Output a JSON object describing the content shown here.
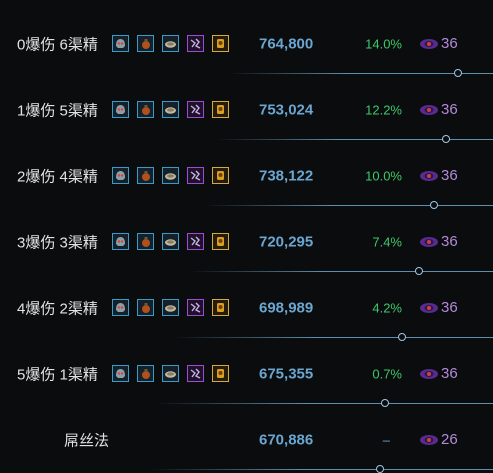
{
  "colors": {
    "label": "#e2e2e2",
    "dps": "#6aa6d0",
    "gain": "#3ec86a",
    "ilvl": "#b48ad8",
    "track": "#5f8fb0",
    "background": "#0b0c0e"
  },
  "rows": [
    {
      "label": "0爆伤 6渠精",
      "has_items": true,
      "dps": "764,800",
      "gain": "14.0%",
      "ilvl_icon": "item-level-icon",
      "ilvl": "36",
      "progress": 0.93
    },
    {
      "label": "1爆伤 5渠精",
      "has_items": true,
      "dps": "753,024",
      "gain": "12.2%",
      "ilvl_icon": "item-level-icon",
      "ilvl": "36",
      "progress": 0.905
    },
    {
      "label": "2爆伤 4渠精",
      "has_items": true,
      "dps": "738,122",
      "gain": "10.0%",
      "ilvl_icon": "item-level-icon",
      "ilvl": "36",
      "progress": 0.88
    },
    {
      "label": "3爆伤 3渠精",
      "has_items": true,
      "dps": "720,295",
      "gain": "7.4%",
      "ilvl_icon": "item-level-icon",
      "ilvl": "36",
      "progress": 0.85
    },
    {
      "label": "4爆伤 2渠精",
      "has_items": true,
      "dps": "698,989",
      "gain": "4.2%",
      "ilvl_icon": "item-level-icon",
      "ilvl": "36",
      "progress": 0.815
    },
    {
      "label": "5爆伤 1渠精",
      "has_items": true,
      "dps": "675,355",
      "gain": "0.7%",
      "ilvl_icon": "item-level-icon",
      "ilvl": "36",
      "progress": 0.78
    },
    {
      "label": "屌丝法",
      "has_items": false,
      "dps": "670,886",
      "gain": "–",
      "ilvl_icon": "item-level-icon",
      "ilvl": "26",
      "progress": 0.77
    }
  ],
  "item_icons": [
    {
      "name": "helm-icon",
      "frame": "blue"
    },
    {
      "name": "potion-icon",
      "frame": "blue"
    },
    {
      "name": "bread-icon",
      "frame": "blue"
    },
    {
      "name": "rune-icon",
      "frame": "purple"
    },
    {
      "name": "trinket-icon",
      "frame": "gold"
    }
  ]
}
